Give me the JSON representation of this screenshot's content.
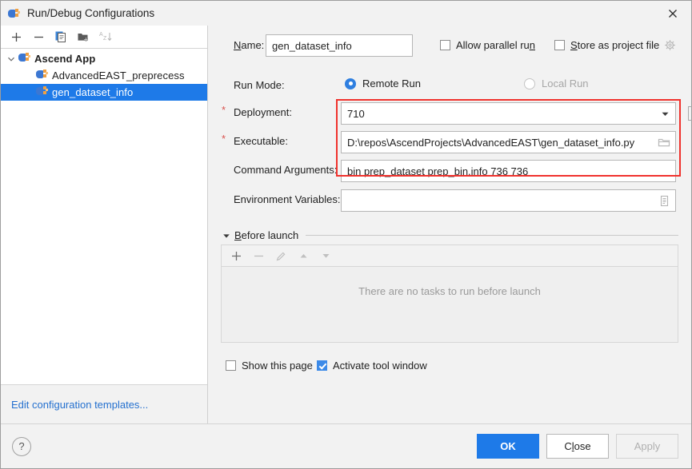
{
  "window": {
    "title": "Run/Debug Configurations",
    "icon": "ascend-app-icon",
    "close_label": "✕"
  },
  "tree_toolbar": {
    "buttons": [
      {
        "name": "add-configuration-button",
        "icon": "plus-icon",
        "enabled": true
      },
      {
        "name": "remove-configuration-button",
        "icon": "minus-icon",
        "enabled": true
      },
      {
        "name": "copy-configuration-button",
        "icon": "copy-icon",
        "enabled": true
      },
      {
        "name": "new-folder-button",
        "icon": "folder-add-icon",
        "enabled": true
      },
      {
        "name": "sort-configurations-button",
        "icon": "sort-alphabetical-icon",
        "enabled": false
      }
    ]
  },
  "tree": {
    "nodes": [
      {
        "label": "Ascend App",
        "level": 0,
        "group": true,
        "expanded": true,
        "selected": false
      },
      {
        "label": "AdvancedEAST_preprecess",
        "level": 1,
        "group": false,
        "selected": false
      },
      {
        "label": "gen_dataset_info",
        "level": 1,
        "group": false,
        "selected": true
      }
    ],
    "edit_templates_link": "Edit configuration templates..."
  },
  "form": {
    "name_label": "Name:",
    "name_mnemonic": "N",
    "name_value": "gen_dataset_info",
    "allow_parallel_run": {
      "label": "Allow parallel run",
      "mnemonic": "n",
      "checked": false
    },
    "store_as_project_file": {
      "label": "Store as project file",
      "mnemonic": "S",
      "checked": false,
      "icon": "gear-icon"
    },
    "run_mode_label": "Run Mode:",
    "run_mode_options": [
      {
        "label": "Remote Run",
        "selected": true,
        "enabled": true
      },
      {
        "label": "Local Run",
        "selected": false,
        "enabled": false
      }
    ],
    "deployment_label": "Deployment:",
    "deployment_required": "*",
    "deployment_value": "710",
    "deployment_add_button_icon": "plus-box-icon",
    "executable_label": "Executable:",
    "executable_required": "*",
    "executable_value": "D:\\repos\\AscendProjects\\AdvancedEAST\\gen_dataset_info.py",
    "executable_browse_icon": "folder-icon",
    "command_arguments_label": "Command Arguments:",
    "command_arguments_value": "bin prep_dataset prep_bin.info 736 736",
    "environment_variables_label": "Environment Variables:",
    "environment_variables_value": "",
    "environment_variables_icon": "list-edit-icon",
    "highlight_color": "#f0322d"
  },
  "before_launch": {
    "title": "Before launch",
    "mnemonic": "B",
    "expanded": true,
    "toolbar": [
      {
        "name": "add-task-button",
        "icon": "plus-icon",
        "enabled": true
      },
      {
        "name": "remove-task-button",
        "icon": "minus-icon",
        "enabled": false
      },
      {
        "name": "edit-task-button",
        "icon": "pencil-icon",
        "enabled": false
      },
      {
        "name": "move-task-up-button",
        "icon": "arrow-up-icon",
        "enabled": false
      },
      {
        "name": "move-task-down-button",
        "icon": "arrow-down-icon",
        "enabled": false
      }
    ],
    "empty_text": "There are no tasks to run before launch",
    "show_this_page": {
      "label": "Show this page",
      "checked": false
    },
    "activate_tool_window": {
      "label": "Activate tool window",
      "checked": true
    }
  },
  "footer": {
    "help_icon": "question-mark-icon",
    "buttons": [
      {
        "name": "ok-button",
        "label": "OK",
        "style": "primary",
        "enabled": true
      },
      {
        "name": "close-button",
        "label": "Close",
        "mnemonic": "l",
        "style": "default",
        "enabled": true
      },
      {
        "name": "apply-button",
        "label": "Apply",
        "style": "default",
        "enabled": false
      }
    ]
  }
}
